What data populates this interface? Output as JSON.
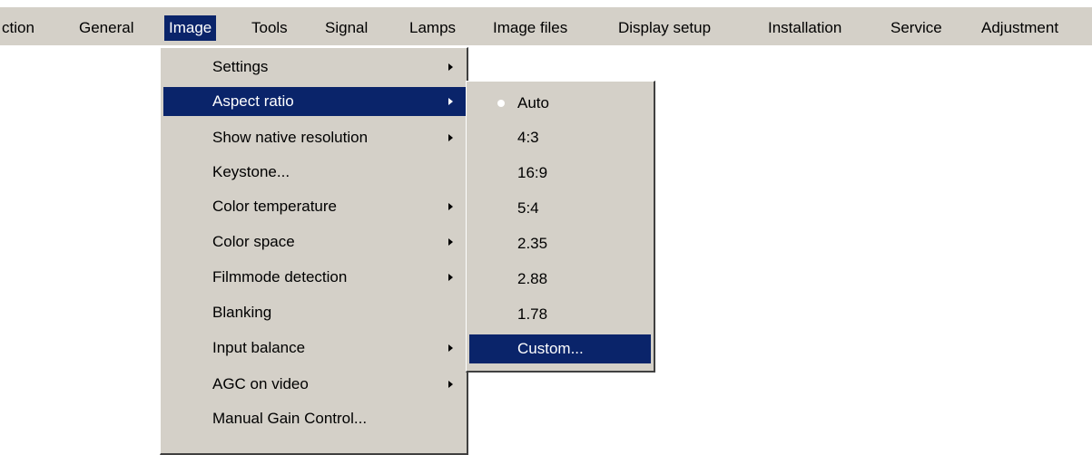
{
  "menubar": {
    "items": [
      {
        "label": "ction",
        "active": false
      },
      {
        "label": "General",
        "active": false
      },
      {
        "label": "Image",
        "active": true
      },
      {
        "label": "Tools",
        "active": false
      },
      {
        "label": "Signal",
        "active": false
      },
      {
        "label": "Lamps",
        "active": false
      },
      {
        "label": "Image files",
        "active": false
      },
      {
        "label": "Display setup",
        "active": false
      },
      {
        "label": "Installation",
        "active": false
      },
      {
        "label": "Service",
        "active": false
      },
      {
        "label": "Adjustment",
        "active": false
      }
    ]
  },
  "image_menu": {
    "items": [
      {
        "label": "Settings",
        "has_submenu": true,
        "active": false
      },
      {
        "label": "Aspect ratio",
        "has_submenu": true,
        "active": true
      },
      {
        "label": "Show native resolution",
        "has_submenu": true,
        "active": false
      },
      {
        "label": "Keystone...",
        "has_submenu": false,
        "active": false
      },
      {
        "label": "Color temperature",
        "has_submenu": true,
        "active": false
      },
      {
        "label": "Color space",
        "has_submenu": true,
        "active": false
      },
      {
        "label": "Filmmode detection",
        "has_submenu": true,
        "active": false
      },
      {
        "label": "Blanking",
        "has_submenu": false,
        "active": false
      },
      {
        "label": "Input balance",
        "has_submenu": true,
        "active": false
      },
      {
        "label": "AGC on video",
        "has_submenu": true,
        "active": false
      },
      {
        "label": "Manual Gain Control...",
        "has_submenu": false,
        "active": false
      }
    ]
  },
  "aspect_ratio_menu": {
    "selected": "Auto",
    "items": [
      {
        "label": "Auto",
        "active": false
      },
      {
        "label": "4:3",
        "active": false
      },
      {
        "label": "16:9",
        "active": false
      },
      {
        "label": "5:4",
        "active": false
      },
      {
        "label": "2.35",
        "active": false
      },
      {
        "label": "2.88",
        "active": false
      },
      {
        "label": "1.78",
        "active": false
      },
      {
        "label": "Custom...",
        "active": true
      }
    ]
  },
  "colors": {
    "menu_background": "#d4d0c8",
    "highlight": "#0a246a",
    "highlight_text": "#ffffff"
  }
}
